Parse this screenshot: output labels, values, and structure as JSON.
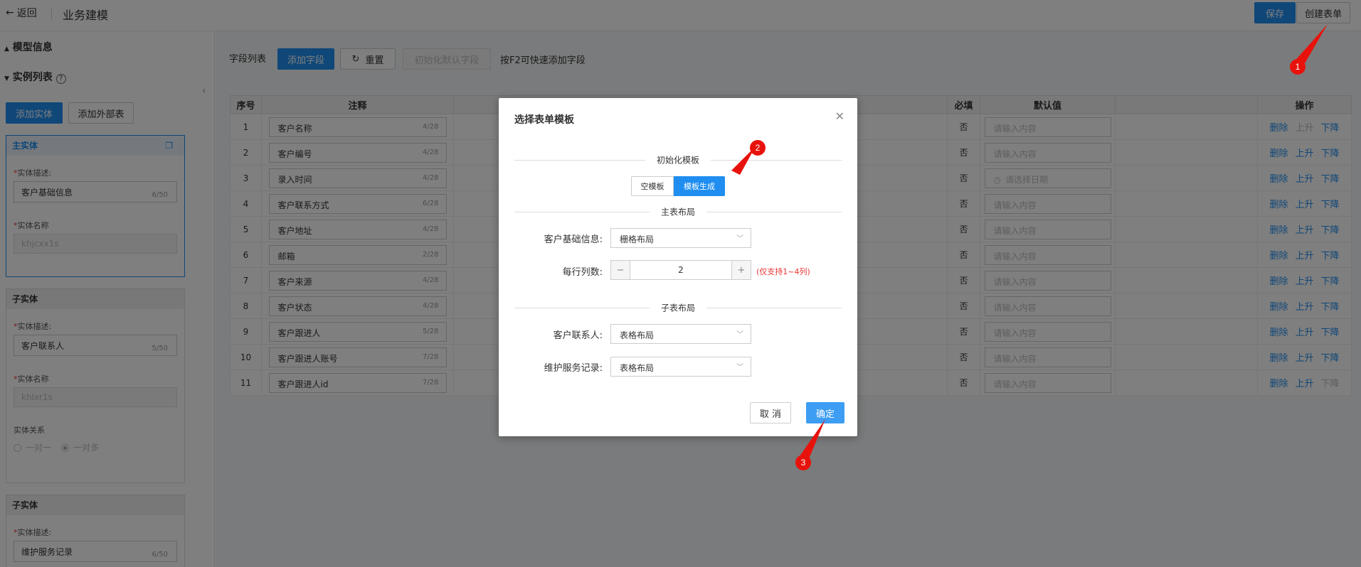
{
  "topbar": {
    "back_label": "返回",
    "title": "业务建模",
    "save_label": "保存",
    "create_form_label": "创建表单"
  },
  "left": {
    "model_info": "模型信息",
    "instance_list": "实例列表",
    "add_entity": "添加实体",
    "add_external": "添加外部表",
    "entities": [
      {
        "head": "主实体",
        "desc_label": "实体描述:",
        "desc": "客户基础信息",
        "desc_count": "6/50",
        "name_label": "实体名称",
        "name": "khjcxx1s"
      },
      {
        "head": "子实体",
        "desc_label": "实体描述:",
        "desc": "客户联系人",
        "desc_count": "5/50",
        "name_label": "实体名称",
        "name": "khlxr1s",
        "rel_label": "实体关系",
        "rel_opt1": "一对一",
        "rel_opt2": "一对多"
      },
      {
        "head": "子实体",
        "desc_label": "实体描述:",
        "desc": "维护服务记录",
        "desc_count": "6/50"
      }
    ]
  },
  "toolbar": {
    "field_list": "字段列表",
    "add_field": "添加字段",
    "reset": "重置",
    "init_default": "初始化默认字段",
    "hint": "按F2可快速添加字段"
  },
  "table": {
    "headers": [
      "序号",
      "注释",
      "必填",
      "默认值",
      "操作"
    ],
    "rows": [
      {
        "no": "1",
        "name": "客户名称",
        "count": "4/28",
        "req": "否",
        "default": "请输入内容",
        "up_disabled": true,
        "down_disabled": false
      },
      {
        "no": "2",
        "name": "客户编号",
        "count": "4/28",
        "req": "否",
        "default": "请输入内容",
        "up_disabled": false,
        "down_disabled": false
      },
      {
        "no": "3",
        "name": "录入时间",
        "count": "4/28",
        "req": "否",
        "default": "请选择日期",
        "up_disabled": false,
        "down_disabled": false
      },
      {
        "no": "4",
        "name": "客户联系方式",
        "count": "6/28",
        "req": "否",
        "default": "请输入内容",
        "up_disabled": false,
        "down_disabled": false
      },
      {
        "no": "5",
        "name": "客户地址",
        "count": "4/28",
        "req": "否",
        "default": "请输入内容",
        "up_disabled": false,
        "down_disabled": false
      },
      {
        "no": "6",
        "name": "邮箱",
        "count": "2/28",
        "req": "否",
        "default": "请输入内容",
        "up_disabled": false,
        "down_disabled": false
      },
      {
        "no": "7",
        "name": "客户来源",
        "count": "4/28",
        "req": "否",
        "default": "请输入内容",
        "up_disabled": false,
        "down_disabled": false
      },
      {
        "no": "8",
        "name": "客户状态",
        "count": "4/28",
        "req": "否",
        "default": "请输入内容",
        "up_disabled": false,
        "down_disabled": false
      },
      {
        "no": "9",
        "name": "客户跟进人",
        "count": "5/28",
        "req": "否",
        "default": "请输入内容",
        "up_disabled": false,
        "down_disabled": false
      },
      {
        "no": "10",
        "name": "客户跟进人账号",
        "count": "7/28",
        "req": "否",
        "default": "请输入内容",
        "up_disabled": false,
        "down_disabled": false
      },
      {
        "no": "11",
        "name": "客户跟进人id",
        "count": "7/28",
        "req": "否",
        "default": "请输入内容",
        "up_disabled": false,
        "down_disabled": true
      }
    ],
    "op_delete": "删除",
    "op_up": "上升",
    "op_down": "下降"
  },
  "modal": {
    "title": "选择表单模板",
    "init_template": "初始化模板",
    "seg_empty": "空模板",
    "seg_template": "模板生成",
    "main_layout": "主表布局",
    "basic_info_label": "客户基础信息:",
    "basic_info_value": "栅格布局",
    "cols_label": "每行列数:",
    "cols_value": "2",
    "cols_hint": "(仅支持1~4列)",
    "sub_layout": "子表布局",
    "contact_label": "客户联系人:",
    "contact_value": "表格布局",
    "service_label": "维护服务记录:",
    "service_value": "表格布局",
    "cancel": "取 消",
    "confirm": "确定"
  },
  "annotations": [
    "1",
    "2",
    "3"
  ],
  "colors": {
    "primary": "#1f8ef0",
    "annotation": "#e8120c"
  }
}
